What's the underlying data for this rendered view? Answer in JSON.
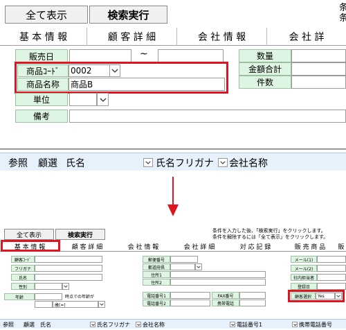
{
  "top": {
    "show_all_btn": "全て表示",
    "search_btn": "検索実行",
    "tabs": [
      "基 本 情 報",
      "顧 客 詳 細",
      "会 社 情 報",
      "会 社 詳"
    ],
    "fields": {
      "sales_date": "販売日",
      "tilde": "~",
      "quantity": "数量",
      "amount_total": "金額合計",
      "count": "件数",
      "product_code_label": "商品ｺｰﾄﾞ",
      "product_code_value": "0002",
      "product_name_label": "商品名称",
      "product_name_value": "商品B",
      "unit": "単位",
      "remarks": "備考"
    },
    "list_header": {
      "ref": "参照",
      "select": "顧選",
      "name": "氏名",
      "kana": "氏名フリガナ",
      "company": "会社名称"
    }
  },
  "bottom": {
    "show_all_btn": "全て表示",
    "search_btn": "検索実行",
    "instruction_line1": "条件を入力した後、「検索実行」をクリックします。",
    "instruction_line2": "条件を解除するには「全て表示」をクリックします。",
    "tabs": [
      "基 本 情 報",
      "顧 客 詳 細",
      "会 社 情 報",
      "会 社 詳 細",
      "対 応 記 録",
      "販 売 商 品",
      "販"
    ],
    "fields": {
      "customer_code": "顧客ｺｰﾄﾞ",
      "furigana": "フリガナ",
      "name": "氏名",
      "gender": "性別",
      "age": "年齢",
      "age_note": "時点での年齢が",
      "age_condition": "歳(=)",
      "postal_code": "郵便番号",
      "prefecture": "都道府県",
      "address1": "住所1",
      "address2": "住所2",
      "phone1": "電話番号1",
      "phone2": "電話番号2",
      "fax": "FAX番号",
      "mobile": "携帯電話",
      "mail1": "メール(1)",
      "mail2": "メール(2)",
      "staff": "社内担当者",
      "register_date": "登録日",
      "customer_select_label": "顧客選択",
      "customer_select_value": "Yes"
    },
    "list_header": {
      "ref": "参照",
      "select": "顧選",
      "name": "氏名",
      "kana": "氏名フリガナ",
      "company": "会社名称",
      "phone1": "電話番号1",
      "mobile": "携帯電話番号"
    }
  },
  "colors": {
    "highlight": "#e0141e",
    "label_bg": "#dff5e3",
    "header_bg": "#e6f1fb"
  }
}
